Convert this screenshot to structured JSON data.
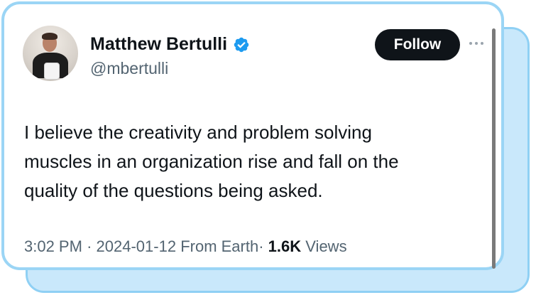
{
  "tweet": {
    "author": {
      "display_name": "Matthew Bertulli",
      "handle": "@mbertulli",
      "verified": true
    },
    "follow_label": "Follow",
    "text_lines": [
      "I believe the creativity and problem solving",
      "muscles in an organization rise and fall on the",
      "quality of the questions being asked."
    ],
    "meta": {
      "time": "3:02 PM",
      "separator": "·",
      "date": "2024-01-12",
      "location": "From Earth",
      "views_count": "1.6K",
      "views_label": "Views"
    }
  },
  "colors": {
    "accent_border": "#9bd5f5",
    "back_card": "#c9e8fb",
    "verified": "#1d9bf0",
    "follow_bg": "#0f1419"
  },
  "icons": {
    "verified": "verified-badge-icon",
    "more": "more-options-icon",
    "avatar": "profile-avatar"
  }
}
